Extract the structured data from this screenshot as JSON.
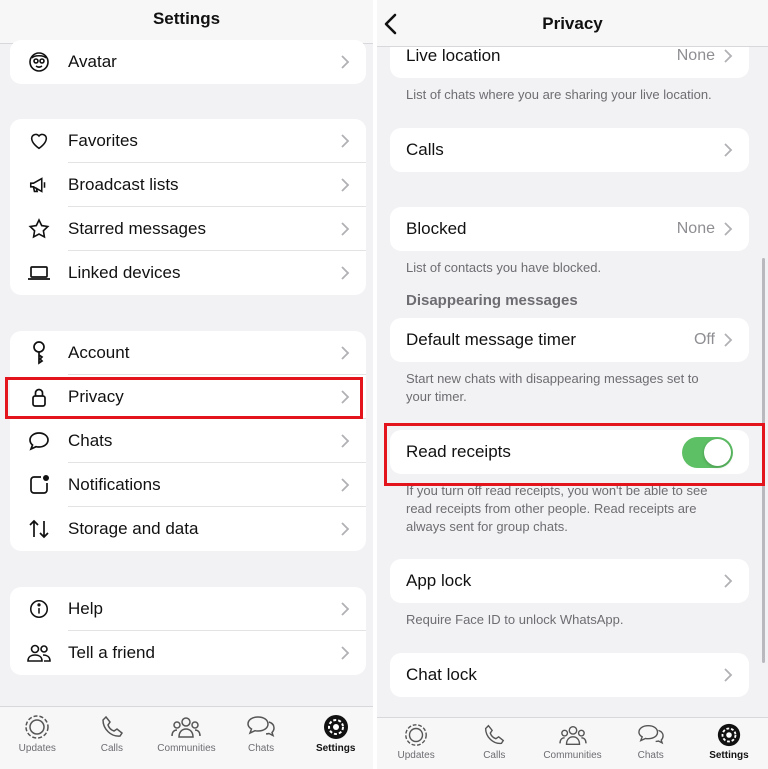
{
  "left": {
    "title": "Settings",
    "groups": [
      {
        "items": [
          {
            "label": "Avatar",
            "icon": "avatar-icon"
          }
        ]
      },
      {
        "items": [
          {
            "label": "Favorites",
            "icon": "heart-icon"
          },
          {
            "label": "Broadcast lists",
            "icon": "megaphone-icon"
          },
          {
            "label": "Starred messages",
            "icon": "star-icon"
          },
          {
            "label": "Linked devices",
            "icon": "laptop-icon"
          }
        ]
      },
      {
        "items": [
          {
            "label": "Account",
            "icon": "key-icon"
          },
          {
            "label": "Privacy",
            "icon": "lock-icon"
          },
          {
            "label": "Chats",
            "icon": "chat-bubble-icon"
          },
          {
            "label": "Notifications",
            "icon": "notification-icon"
          },
          {
            "label": "Storage and data",
            "icon": "arrows-updown-icon"
          }
        ]
      },
      {
        "items": [
          {
            "label": "Help",
            "icon": "info-icon"
          },
          {
            "label": "Tell a friend",
            "icon": "people-icon"
          }
        ]
      }
    ],
    "tabs": [
      {
        "label": "Updates",
        "icon": "updates-icon"
      },
      {
        "label": "Calls",
        "icon": "phone-icon"
      },
      {
        "label": "Communities",
        "icon": "communities-icon"
      },
      {
        "label": "Chats",
        "icon": "chats-tab-icon"
      },
      {
        "label": "Settings",
        "icon": "settings-gear-icon",
        "active": true
      }
    ]
  },
  "right": {
    "title": "Privacy",
    "live_location": {
      "label": "Live location",
      "value": "None"
    },
    "live_location_note": "List of chats where you are sharing your live location.",
    "calls": {
      "label": "Calls"
    },
    "blocked": {
      "label": "Blocked",
      "value": "None"
    },
    "blocked_note": "List of contacts you have blocked.",
    "disappearing_header": "Disappearing messages",
    "default_timer": {
      "label": "Default message timer",
      "value": "Off"
    },
    "timer_note_1": "Start new chats with disappearing messages set to",
    "timer_note_2": "your timer.",
    "read_receipts": {
      "label": "Read receipts",
      "enabled": true
    },
    "receipts_note_1": "If you turn off read receipts, you won't be able to see",
    "receipts_note_2": "read receipts from other people. Read receipts are",
    "receipts_note_3": "always sent for group chats.",
    "app_lock": {
      "label": "App lock"
    },
    "app_lock_note": "Require Face ID to unlock WhatsApp.",
    "chat_lock": {
      "label": "Chat lock"
    },
    "tabs": [
      {
        "label": "Updates",
        "icon": "updates-icon"
      },
      {
        "label": "Calls",
        "icon": "phone-icon"
      },
      {
        "label": "Communities",
        "icon": "communities-icon"
      },
      {
        "label": "Chats",
        "icon": "chats-tab-icon"
      },
      {
        "label": "Settings",
        "icon": "settings-gear-icon",
        "active": true
      }
    ]
  },
  "colors": {
    "highlight": "#e3141b",
    "toggle_on": "#5ec065",
    "secondary_text": "#6d6d72"
  }
}
